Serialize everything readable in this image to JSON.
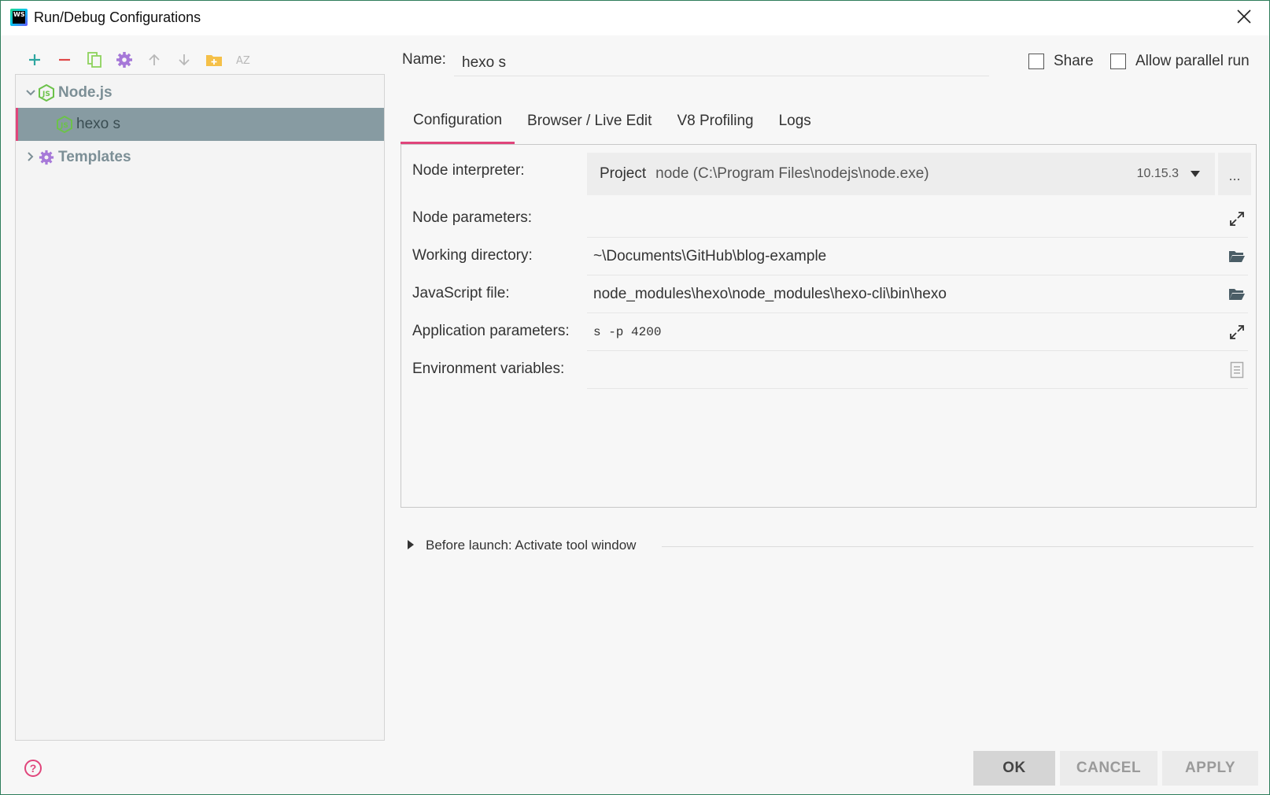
{
  "window": {
    "app_icon_text": "WS",
    "title": "Run/Debug Configurations"
  },
  "toolbar": {
    "buttons": [
      "add-icon",
      "remove-icon",
      "copy-icon",
      "edit-defaults-icon",
      "move-up-icon",
      "move-down-icon",
      "folder-add-icon",
      "sort-az-icon"
    ]
  },
  "tree": {
    "group": "Node.js",
    "item": "hexo s",
    "templates": "Templates"
  },
  "name": {
    "label": "Name:",
    "value": "hexo s"
  },
  "options": {
    "share": "Share",
    "parallel": "Allow parallel run"
  },
  "tabs": [
    {
      "label": "Configuration"
    },
    {
      "label": "Browser / Live Edit"
    },
    {
      "label": "V8 Profiling"
    },
    {
      "label": "Logs"
    }
  ],
  "config": {
    "interpreter_label": "Node interpreter:",
    "interpreter_kind": "Project",
    "interpreter_path": "node (C:\\Program Files\\nodejs\\node.exe)",
    "interpreter_version": "10.15.3",
    "ellipsis": "...",
    "node_params_label": "Node parameters:",
    "node_params_value": "",
    "workdir_label": "Working directory:",
    "workdir_value": "~\\Documents\\GitHub\\blog-example",
    "jsfile_label": "JavaScript file:",
    "jsfile_value": "node_modules\\hexo\\node_modules\\hexo-cli\\bin\\hexo",
    "app_params_label": "Application parameters:",
    "app_params_value": "s -p 4200",
    "env_label": "Environment variables:",
    "env_value": ""
  },
  "before_launch": "Before launch: Activate tool window",
  "buttons": {
    "ok": "OK",
    "cancel": "CANCEL",
    "apply": "APPLY"
  },
  "colors": {
    "accent": "#e0457b",
    "selection": "#879ba2",
    "node_green": "#6cc24a"
  }
}
